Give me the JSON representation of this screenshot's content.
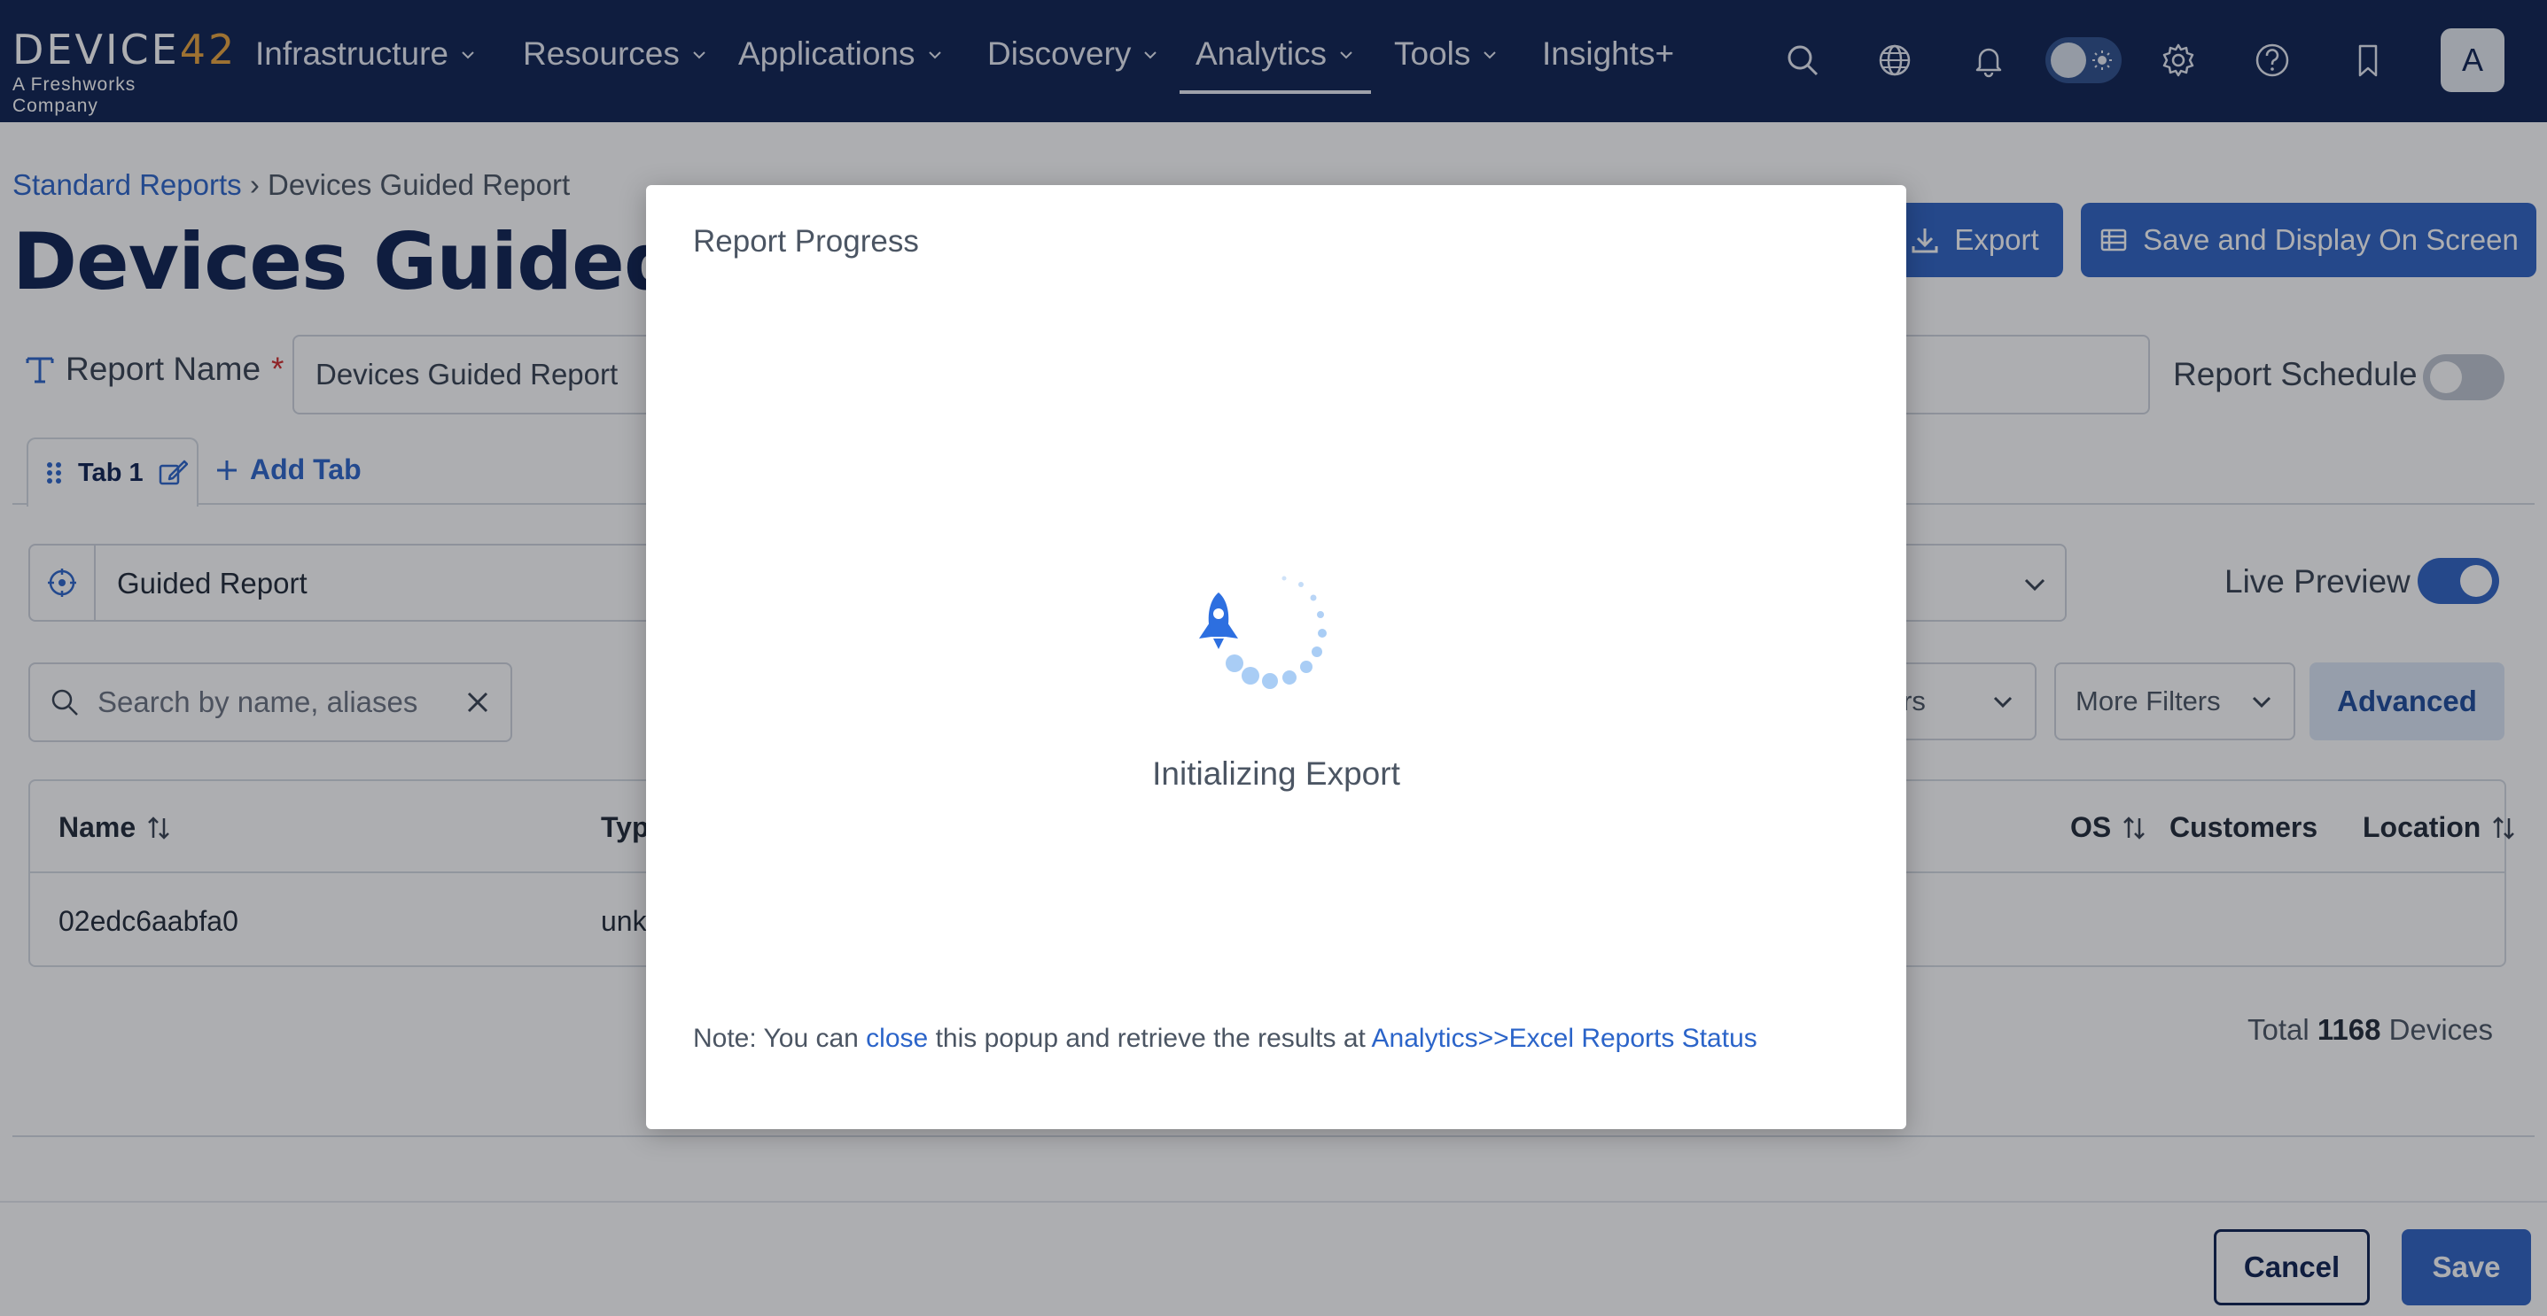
{
  "nav": {
    "logo_text": "DEVICE42",
    "logo_sub": "A Freshworks Company",
    "items": [
      {
        "label": "Infrastructure"
      },
      {
        "label": "Resources"
      },
      {
        "label": "Applications"
      },
      {
        "label": "Discovery"
      },
      {
        "label": "Analytics"
      },
      {
        "label": "Tools"
      },
      {
        "label": "Insights+"
      }
    ],
    "active_item": "Analytics",
    "avatar_initial": "A"
  },
  "breadcrumb": {
    "parent": "Standard Reports",
    "separator": "›",
    "current": "Devices Guided Report"
  },
  "page": {
    "title": "Devices Guided Report",
    "export_label": "Export",
    "save_display_label": "Save and Display On Screen"
  },
  "report_name": {
    "label": "Report Name",
    "required_mark": "*",
    "value": "Devices Guided Report"
  },
  "report_schedule": {
    "label": "Report Schedule",
    "enabled": false
  },
  "tabs": {
    "items": [
      {
        "label": "Tab 1"
      }
    ],
    "add_label": "Add Tab"
  },
  "report_type": {
    "value": "Guided Report"
  },
  "live_preview": {
    "label": "Live Preview",
    "enabled": true
  },
  "search": {
    "placeholder": "Search by name, aliases"
  },
  "filters": {
    "customers_partial": "mers",
    "more_filters": "More Filters",
    "advanced": "Advanced"
  },
  "table": {
    "columns": [
      {
        "label": "Name",
        "sortable": true
      },
      {
        "label": "Typ",
        "sortable": false
      },
      {
        "label": "OS",
        "sortable": true
      },
      {
        "label": "Customers",
        "sortable": false
      },
      {
        "label": "Location",
        "sortable": true
      }
    ],
    "rows": [
      {
        "name": "02edc6aabfa0",
        "type_partial": "unk"
      }
    ]
  },
  "total": {
    "prefix": "Total",
    "count": "1168",
    "suffix": "Devices"
  },
  "footer": {
    "cancel_label": "Cancel",
    "save_label": "Save"
  },
  "modal": {
    "title": "Report Progress",
    "status": "Initializing Export",
    "note_prefix": "Note: You can",
    "note_close": "close",
    "note_middle": "this popup and retrieve the results at",
    "note_link": "Analytics>>Excel Reports Status"
  },
  "colors": {
    "nav_bg": "#0d2150",
    "primary": "#2e63c4",
    "link": "#2b64c9",
    "logo_accent": "#e8a33d",
    "spinner_blue": "#2d6fe0",
    "spinner_dots": "#a9cdf5"
  },
  "icons": {
    "nav_right": [
      "search-icon",
      "globe-icon",
      "bell-icon",
      "theme-toggle",
      "gear-icon",
      "help-icon",
      "bookmark-icon"
    ],
    "spinner": "rocket-icon"
  }
}
